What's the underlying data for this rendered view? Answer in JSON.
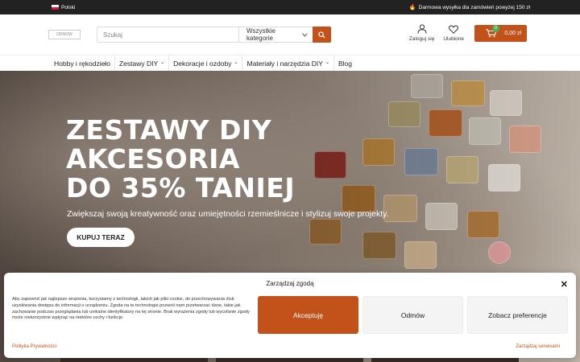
{
  "topbar": {
    "language": "Polski",
    "shipping_note": "Darmowa wysyłka dla zamówień powyżej 150 zł"
  },
  "header": {
    "logo_alt": "DDNOW",
    "search": {
      "placeholder": "Szukaj",
      "value": ""
    },
    "category_select": "Wszystkie kategorie",
    "login_label": "Zaloguj się",
    "favorites_label": "Ulubione",
    "cart": {
      "count": "0",
      "total": "0,00 zł"
    }
  },
  "nav": {
    "items": [
      {
        "label": "Hobby i rękodzieło",
        "has_dropdown": false
      },
      {
        "label": "Zestawy DIY",
        "has_dropdown": true
      },
      {
        "label": "Dekoracje i ozdoby",
        "has_dropdown": true
      },
      {
        "label": "Materiały i narzędzia DIY",
        "has_dropdown": true
      },
      {
        "label": "Blog",
        "has_dropdown": false
      }
    ]
  },
  "hero": {
    "title_line1": "ZESTAWY DIY",
    "title_line2": "AKCESORIA",
    "title_line3": "DO 35% TANIEJ",
    "subtitle": "Zwiększaj swoją kreatywność oraz umiejętności rzemieślnicze i stylizuj swoje projekty.",
    "cta": "KUPUJ TERAZ"
  },
  "consent": {
    "title": "Zarządzaj zgodą",
    "body": "Aby zapewnić jak najlepsze wrażenia, korzystamy z technologii, takich jak pliki cookie, do przechowywania i/lub uzyskiwania dostępu do informacji o urządzeniu. Zgoda na te technologie pozwoli nam przetwarzać dane, takie jak zachowanie podczas przeglądania lub unikalne identyfikatory na tej stronie. Brak wyrażenia zgody lub wycofanie zgody może niekorzystnie wpłynąć na niektóre cechy i funkcje.",
    "accept": "Akceptuję",
    "deny": "Odmów",
    "preferences": "Zobacz preferencje",
    "privacy_link": "Polityka Prywatności",
    "manage_link": "Zarządzaj serwisami"
  },
  "colors": {
    "accent": "#c3511a",
    "topbar": "#222222",
    "cart_badge": "#4caf50"
  }
}
